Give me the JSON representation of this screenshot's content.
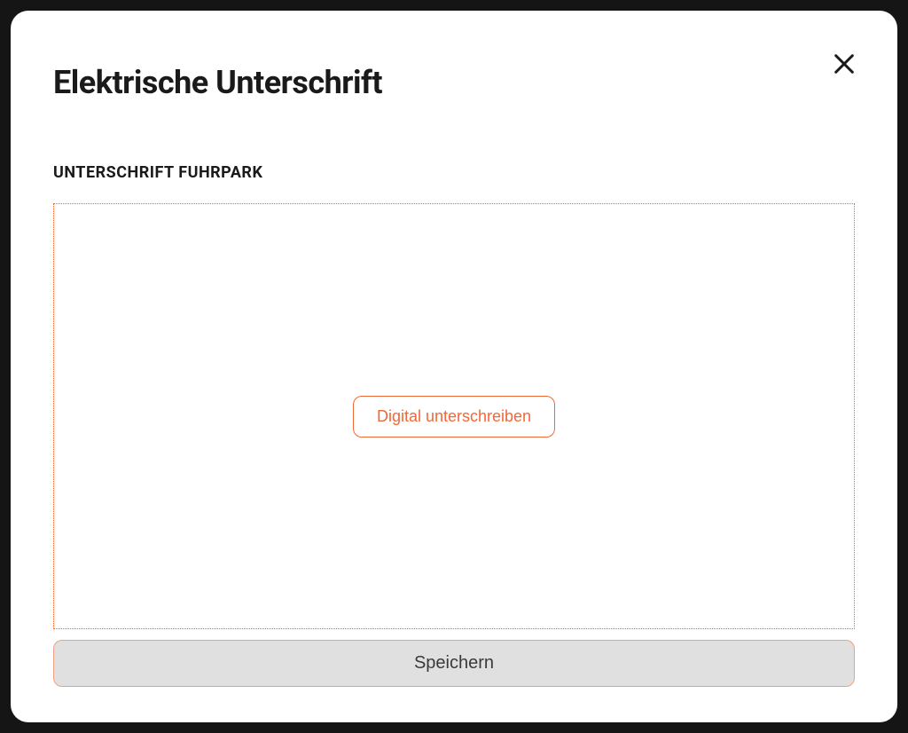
{
  "modal": {
    "title": "Elektrische Unterschrift",
    "section_label": "UNTERSCHRIFT FUHRPARK",
    "sign_button_label": "Digital unterschreiben",
    "save_button_label": "Speichern"
  }
}
